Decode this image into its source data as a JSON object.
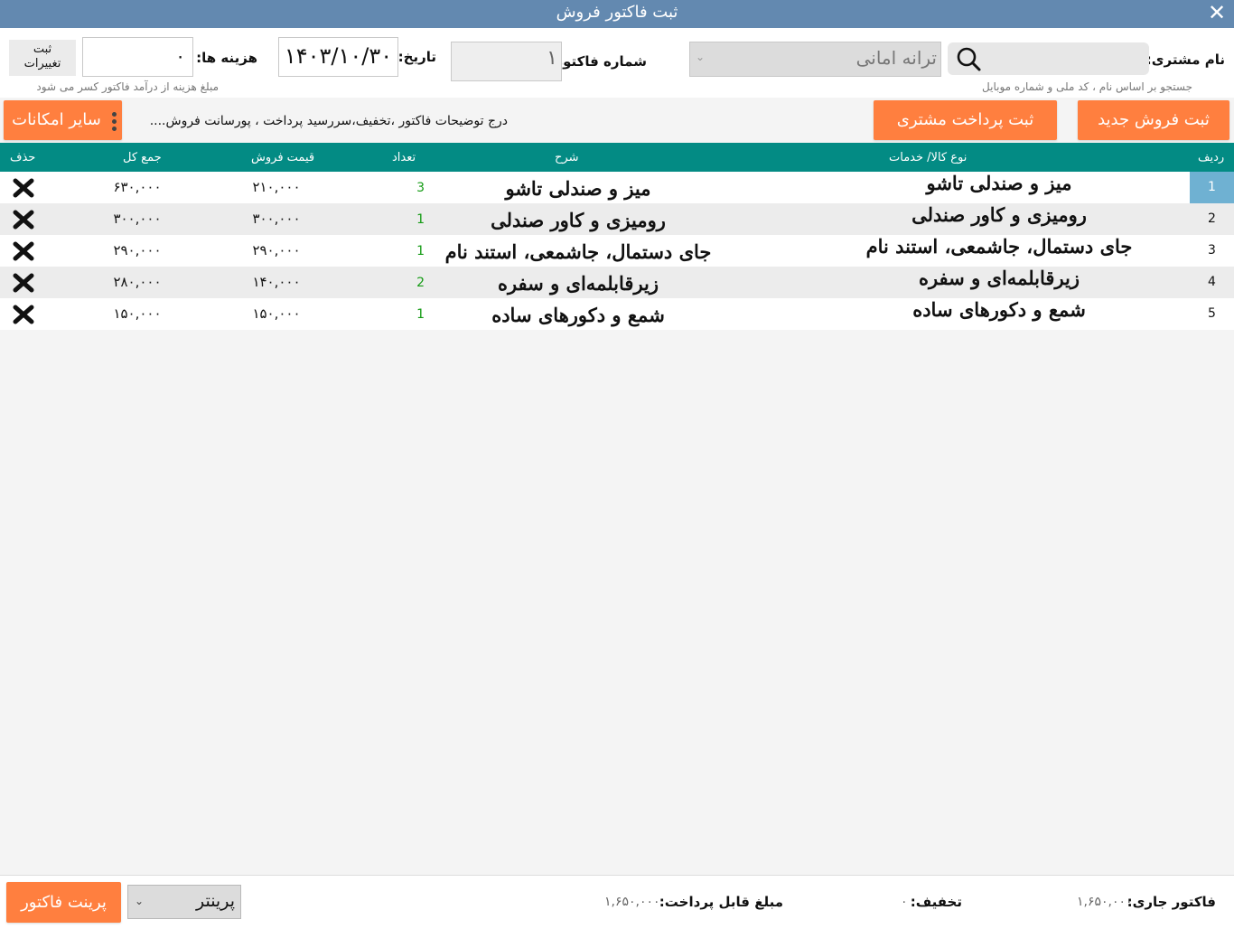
{
  "window": {
    "title": "ثبت فاکتور فروش",
    "close_glyph": "✕"
  },
  "customer": {
    "label": "نام مشتری:",
    "search_placeholder": "",
    "search_hint": "جستجو بر اساس نام ، کد ملی و شماره موبایل",
    "selected": "ترانه امانی",
    "chevron": "⌄"
  },
  "invoice": {
    "number_label": "شماره فاکتور:",
    "number": "۱",
    "date_label": "تاریخ:",
    "date": "۱۴۰۳/۱۰/۳۰",
    "cost_label": "هزینه ها:",
    "cost": "۰",
    "save_changes_line1": "ثبت",
    "save_changes_line2": "تغییرات",
    "cost_hint": "مبلغ هزینه از درآمد فاکتور کسر می شود"
  },
  "actions": {
    "new_sale": "ثبت فروش جدید",
    "customer_payment": "ثبت پرداخت مشتری",
    "notes": "درج توضیحات فاکتور ،تخفیف،سررسید پرداخت ، پورسانت فروش....",
    "more_options": "سایر امکانات"
  },
  "table": {
    "headers": {
      "index": "ردیف",
      "type": "نوع کالا/ خدمات",
      "description": "شرح",
      "qty": "تعداد",
      "price": "قیمت فروش",
      "total": "جمع کل",
      "delete": "حذف"
    },
    "rows": [
      {
        "index": "1",
        "type": "میز و صندلی تاشو",
        "description": "میز و صندلی تاشو",
        "qty": "3",
        "price": "۲۱۰,۰۰۰",
        "total": "۶۳۰,۰۰۰"
      },
      {
        "index": "2",
        "type": "رومیزی و کاور صندلی",
        "description": "رومیزی و کاور صندلی",
        "qty": "1",
        "price": "۳۰۰,۰۰۰",
        "total": "۳۰۰,۰۰۰"
      },
      {
        "index": "3",
        "type": "جای دستمال، جاشمعی، استند نام",
        "description": "جای دستمال، جاشمعی، استند نام",
        "qty": "1",
        "price": "۲۹۰,۰۰۰",
        "total": "۲۹۰,۰۰۰"
      },
      {
        "index": "4",
        "type": "زیرقابلمه‌ای و سفره",
        "description": "زیرقابلمه‌ای و سفره",
        "qty": "2",
        "price": "۱۴۰,۰۰۰",
        "total": "۲۸۰,۰۰۰"
      },
      {
        "index": "5",
        "type": "شمع و دکورهای ساده",
        "description": "شمع و دکورهای ساده",
        "qty": "1",
        "price": "۱۵۰,۰۰۰",
        "total": "۱۵۰,۰۰۰"
      }
    ],
    "selected_row": 0
  },
  "footer": {
    "current_invoice_label": "فاکتور جاری:",
    "current_invoice": "۱,۶۵۰,۰۰۰",
    "discount_label": "تخفیف:",
    "discount": "۰",
    "payable_label": "مبلغ قابل پرداخت:",
    "payable": "۱,۶۵۰,۰۰۰",
    "printer": "پرینتر",
    "printer_chevron": "⌄",
    "print_invoice": "پرینت فاکتور"
  },
  "colors": {
    "titlebar": "#6389b0",
    "accent_orange": "#ff7f3f",
    "table_header": "#038b84",
    "selected_index": "#6fb1d2",
    "qty_green": "#149b14"
  },
  "icons": {
    "search": "search-icon",
    "close": "close-icon",
    "delete": "delete-x-icon",
    "more": "vertical-dots-icon"
  }
}
